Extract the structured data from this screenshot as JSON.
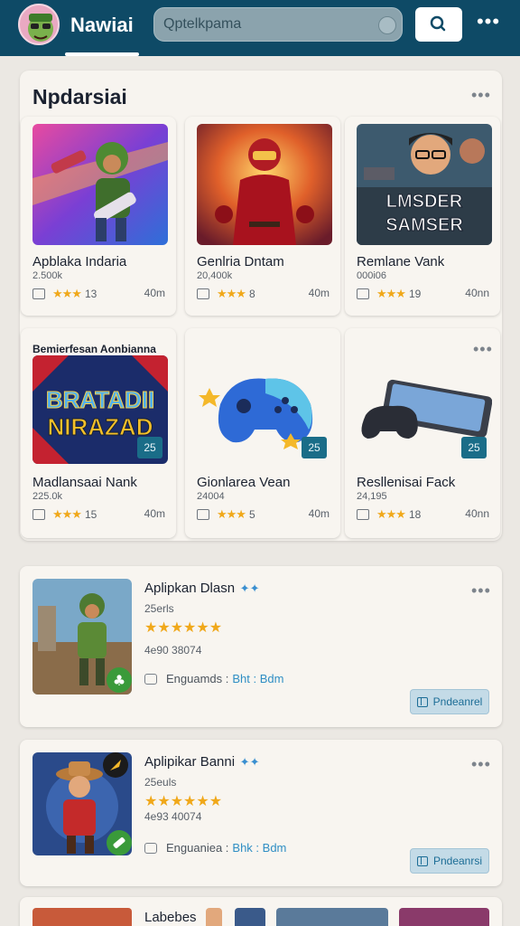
{
  "header": {
    "title": "Nawiai",
    "search_placeholder": "Qptelkpama",
    "search_icon": "search-icon",
    "more_icon": "more-icon"
  },
  "featured": {
    "title": "Npdarsiai",
    "cards": [
      {
        "title": "Apblaka Indaria",
        "sub": "2.500k",
        "rating": "13",
        "size": "40m",
        "badge": ""
      },
      {
        "title": "Genlria Dntam",
        "sub": "20,400k",
        "rating": "8",
        "size": "40m",
        "badge": ""
      },
      {
        "title": "Remlane Vank",
        "sub": "000i06",
        "rating": "19",
        "size": "40nn",
        "badge": "",
        "art_text": [
          "LMSDER",
          "SAMSER"
        ]
      },
      {
        "title": "Madlansaai Nank",
        "sub": "225.0k",
        "rating": "15",
        "size": "40m",
        "badge": "25",
        "heading": "Bemierfesan Aonbianna",
        "art_text": [
          "BRATADII",
          "NIRAZAD"
        ]
      },
      {
        "title": "Gionlarea Vean",
        "sub": "24004",
        "rating": "5",
        "size": "40m",
        "badge": "25"
      },
      {
        "title": "Resllenisai Fack",
        "sub": "24,195",
        "rating": "18",
        "size": "40nn",
        "badge": "25"
      }
    ]
  },
  "list": [
    {
      "title": "Aplipkan Dlasn",
      "sub": "25erls",
      "code": "4e90 38074",
      "lang_label": "Enguamds :",
      "lang_value": "Bht : Bdm",
      "button": "Pndeanrel"
    },
    {
      "title": "Aplipikar Banni",
      "sub": "25euls",
      "code": "4e93 40074",
      "lang_label": "Enguaniea :",
      "lang_value": "Bhk : Bdm",
      "button": "Pndeanrsi"
    }
  ],
  "bottom": {
    "title": "Labebes"
  },
  "colors": {
    "header": "#0e4a66",
    "star": "#f0a81a",
    "badge": "#1a6d88",
    "accent": "#2f8ec4"
  }
}
